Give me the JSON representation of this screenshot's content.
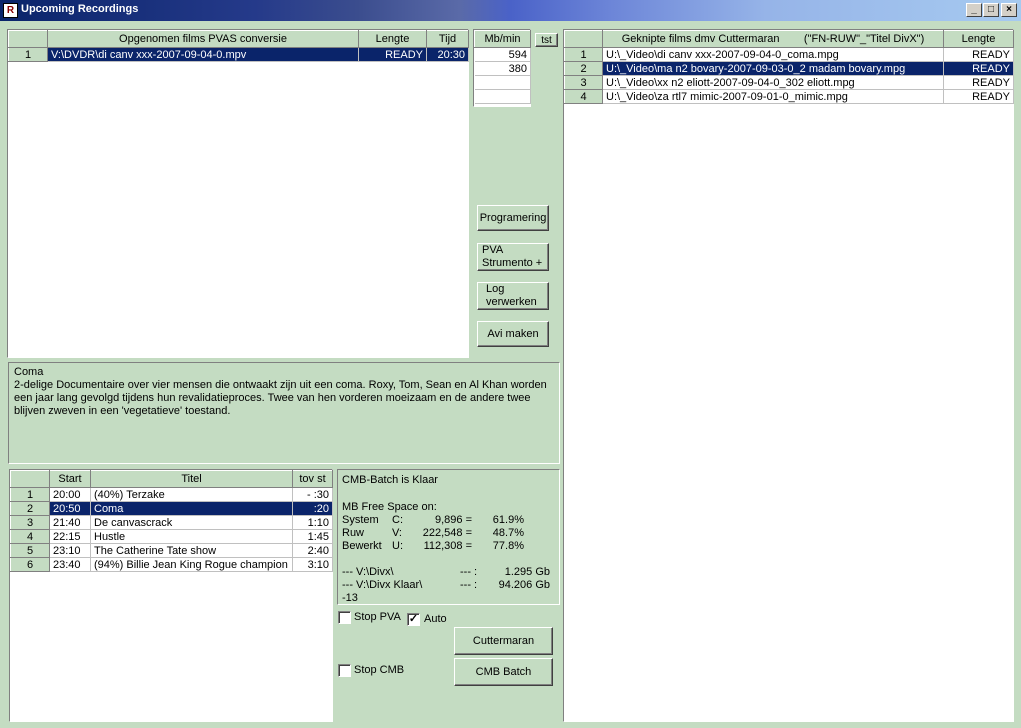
{
  "window": {
    "title": "Upcoming Recordings",
    "icon": "film-icon",
    "minimize": "_",
    "maximize": "□",
    "close": "×"
  },
  "pvas_table": {
    "columns": [
      "",
      "Opgenomen films PVAS conversie",
      "Lengte",
      "Tijd"
    ],
    "rows": [
      {
        "num": "1",
        "file": "V:\\DVDR\\di canv xxx-2007-09-04-0.mpv",
        "length": "READY",
        "time": "20:30"
      }
    ]
  },
  "mbmin": {
    "header": "Mb/min",
    "values": [
      "594",
      "380",
      "",
      "",
      ""
    ]
  },
  "tst_button": "tst",
  "action_buttons": {
    "programering": "Programering",
    "pva_line1": "PVA",
    "pva_line2": "Strumento +",
    "log_line1": "Log",
    "log_line2": "verwerken",
    "avi": "Avi maken"
  },
  "description": {
    "title": "Coma",
    "text": "2-delige Documentaire over vier mensen die ontwaakt zijn uit een coma. Roxy, Tom, Sean en Al Khan worden een jaar lang gevolgd tijdens hun revalidatieproces. Twee van hen vorderen moeizaam en de andere twee blijven zweven in een 'vegetatieve' toestand."
  },
  "schedule": {
    "columns": [
      "",
      "Start",
      "Titel",
      "tov st"
    ],
    "rows": [
      {
        "num": "1",
        "start": "20:00",
        "title": "(40%) Terzake",
        "offset": "- :30"
      },
      {
        "num": "2",
        "start": "20:50",
        "title": "Coma",
        "offset": ":20"
      },
      {
        "num": "3",
        "start": "21:40",
        "title": "De canvascrack",
        "offset": "1:10"
      },
      {
        "num": "4",
        "start": "22:15",
        "title": "Hustle",
        "offset": "1:45"
      },
      {
        "num": "5",
        "start": "23:10",
        "title": "The Catherine Tate show",
        "offset": "2:40"
      },
      {
        "num": "6",
        "start": "23:40",
        "title": "(94%) Billie Jean King Rogue champion",
        "offset": "3:10"
      }
    ],
    "selected": 1
  },
  "status": {
    "line1": "CMB-Batch is Klaar",
    "free_header": "MB Free Space on:",
    "drives": [
      {
        "name": "System",
        "letter": "C:",
        "mb": "9,896 =",
        "pct": "61.9%"
      },
      {
        "name": "Ruw",
        "letter": "V:",
        "mb": "222,548 =",
        "pct": "48.7%"
      },
      {
        "name": "Bewerkt",
        "letter": "U:",
        "mb": "112,308 =",
        "pct": "77.8%"
      }
    ],
    "folders": [
      {
        "path": "--- V:\\Divx\\",
        "sep": "--- :",
        "size": "1.295 Gb"
      },
      {
        "path": "--- V:\\Divx Klaar\\",
        "sep": "--- :",
        "size": "94.206 Gb"
      }
    ],
    "last": "-13"
  },
  "controls": {
    "stop_pva": "Stop PVA",
    "stop_pva_checked": false,
    "auto": "Auto",
    "auto_checked": true,
    "stop_cmb": "Stop CMB",
    "stop_cmb_checked": false,
    "cuttermaran": "Cuttermaran",
    "cmb_batch": "CMB Batch",
    "check_mark": "✓"
  },
  "cut_table": {
    "columns": [
      "",
      "Geknipte films dmv Cuttermaran        (\"FN-RUW\"_\"Titel DivX\")",
      "Lengte"
    ],
    "rows": [
      {
        "num": "1",
        "file": "U:\\_Video\\di canv xxx-2007-09-04-0_coma.mpg",
        "length": "READY"
      },
      {
        "num": "2",
        "file": "U:\\_Video\\ma n2 bovary-2007-09-03-0_2 madam bovary.mpg",
        "length": "READY"
      },
      {
        "num": "3",
        "file": "U:\\_Video\\xx n2 eliott-2007-09-04-0_302 eliott.mpg",
        "length": "READY"
      },
      {
        "num": "4",
        "file": "U:\\_Video\\za rtl7 mimic-2007-09-01-0_mimic.mpg",
        "length": "READY"
      }
    ],
    "selected": 1
  }
}
